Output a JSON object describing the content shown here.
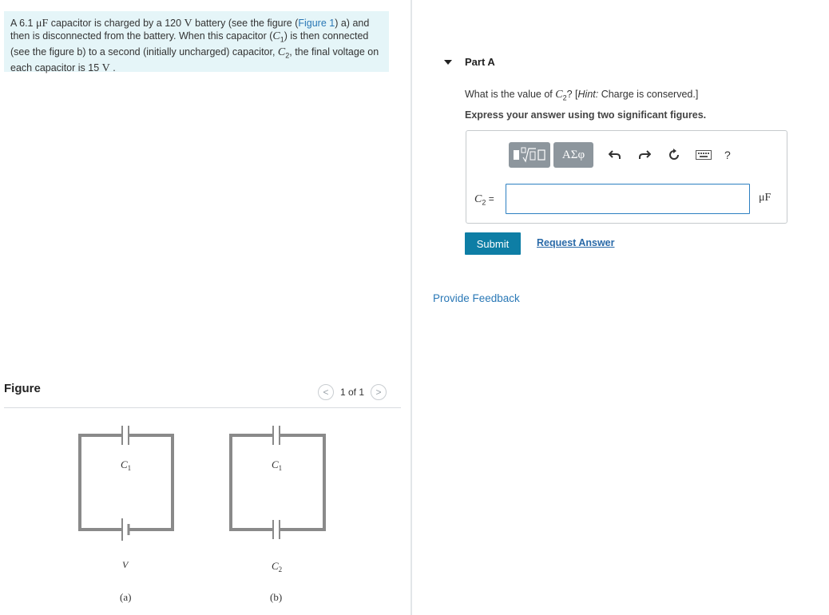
{
  "problem": {
    "s1": "A 6.1 ",
    "unit_mu": "μF",
    "s2": " capacitor is charged by a 120 ",
    "unit_v": "V",
    "s3": " battery (see the figure (",
    "figure_link": "Figure 1",
    "s4": ") a) and then is disconnected from the battery. When this capacitor (",
    "c_letter": "C",
    "c_sub_1": "1",
    "s5": ") is then connected (see the figure b) to a second (initially uncharged) capacitor, ",
    "c_sub_2": "2",
    "s6": ", the final voltage on each capacitor is 15 ",
    "s7": " ."
  },
  "figure": {
    "title": "Figure",
    "pager": "1 of 1",
    "prev_symbol": "<",
    "next_symbol": ">",
    "labels": {
      "c1": "C",
      "c1_sub": "1",
      "c2": "C",
      "c2_sub": "2",
      "v": "V",
      "a": "(a)",
      "b": "(b)"
    }
  },
  "part": {
    "label": "Part A",
    "q_prefix": "What is the value of ",
    "q_var": "C",
    "q_sub": "2",
    "q_mid": "? [",
    "q_hint": "Hint:",
    "q_suffix": " Charge is conserved.]",
    "instruction": "Express your answer using two significant figures.",
    "toolbar": {
      "greek": "ΑΣφ",
      "help": "?",
      "icons": [
        "template-icon",
        "greek-icon",
        "undo-icon",
        "redo-icon",
        "reset-icon",
        "keyboard-icon",
        "help-icon"
      ]
    },
    "answer": {
      "var": "C",
      "sub": "2",
      "eq": " =",
      "value": "",
      "unit": "μF"
    },
    "submit": "Submit",
    "request": "Request Answer"
  },
  "feedback": "Provide Feedback",
  "colors": {
    "problem_bg": "#e5f5f8",
    "link": "#2a78b6",
    "submit_bg": "#0e7ea5",
    "toolbar_btn": "#8d969d",
    "input_border": "#2d7fc1"
  }
}
